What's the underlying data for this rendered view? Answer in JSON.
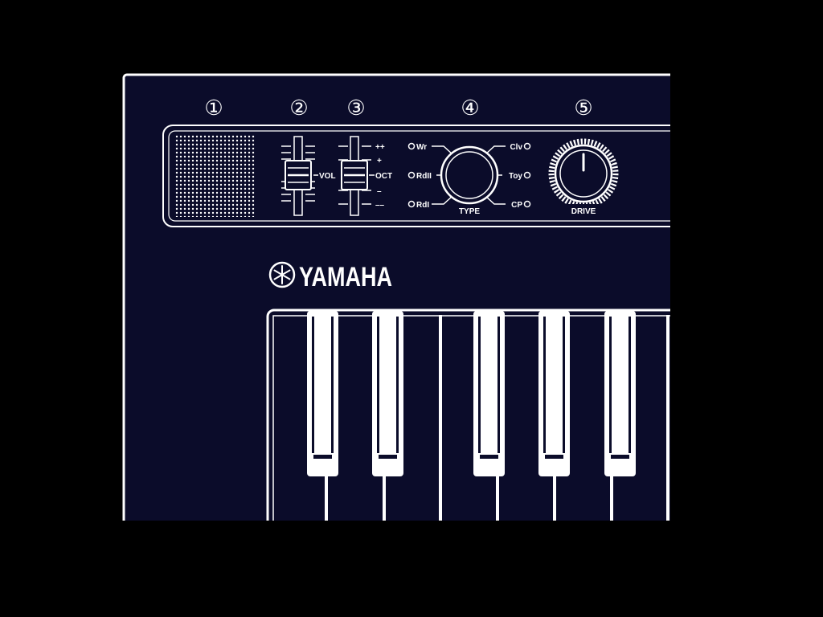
{
  "callouts": [
    "①",
    "②",
    "③",
    "④",
    "⑤"
  ],
  "vol_label": "VOL",
  "oct_label": "OCT",
  "oct_marks": [
    "++",
    "+",
    "–",
    "––"
  ],
  "type_label": "TYPE",
  "type_options": {
    "left": [
      "Wr",
      "RdII",
      "RdI"
    ],
    "right": [
      "Clv",
      "Toy",
      "CP"
    ]
  },
  "drive_label": "DRIVE",
  "brand": "YAMAHA",
  "colors": {
    "background": "#000000",
    "panel": "#0b0c2a",
    "line": "#ffffff"
  }
}
